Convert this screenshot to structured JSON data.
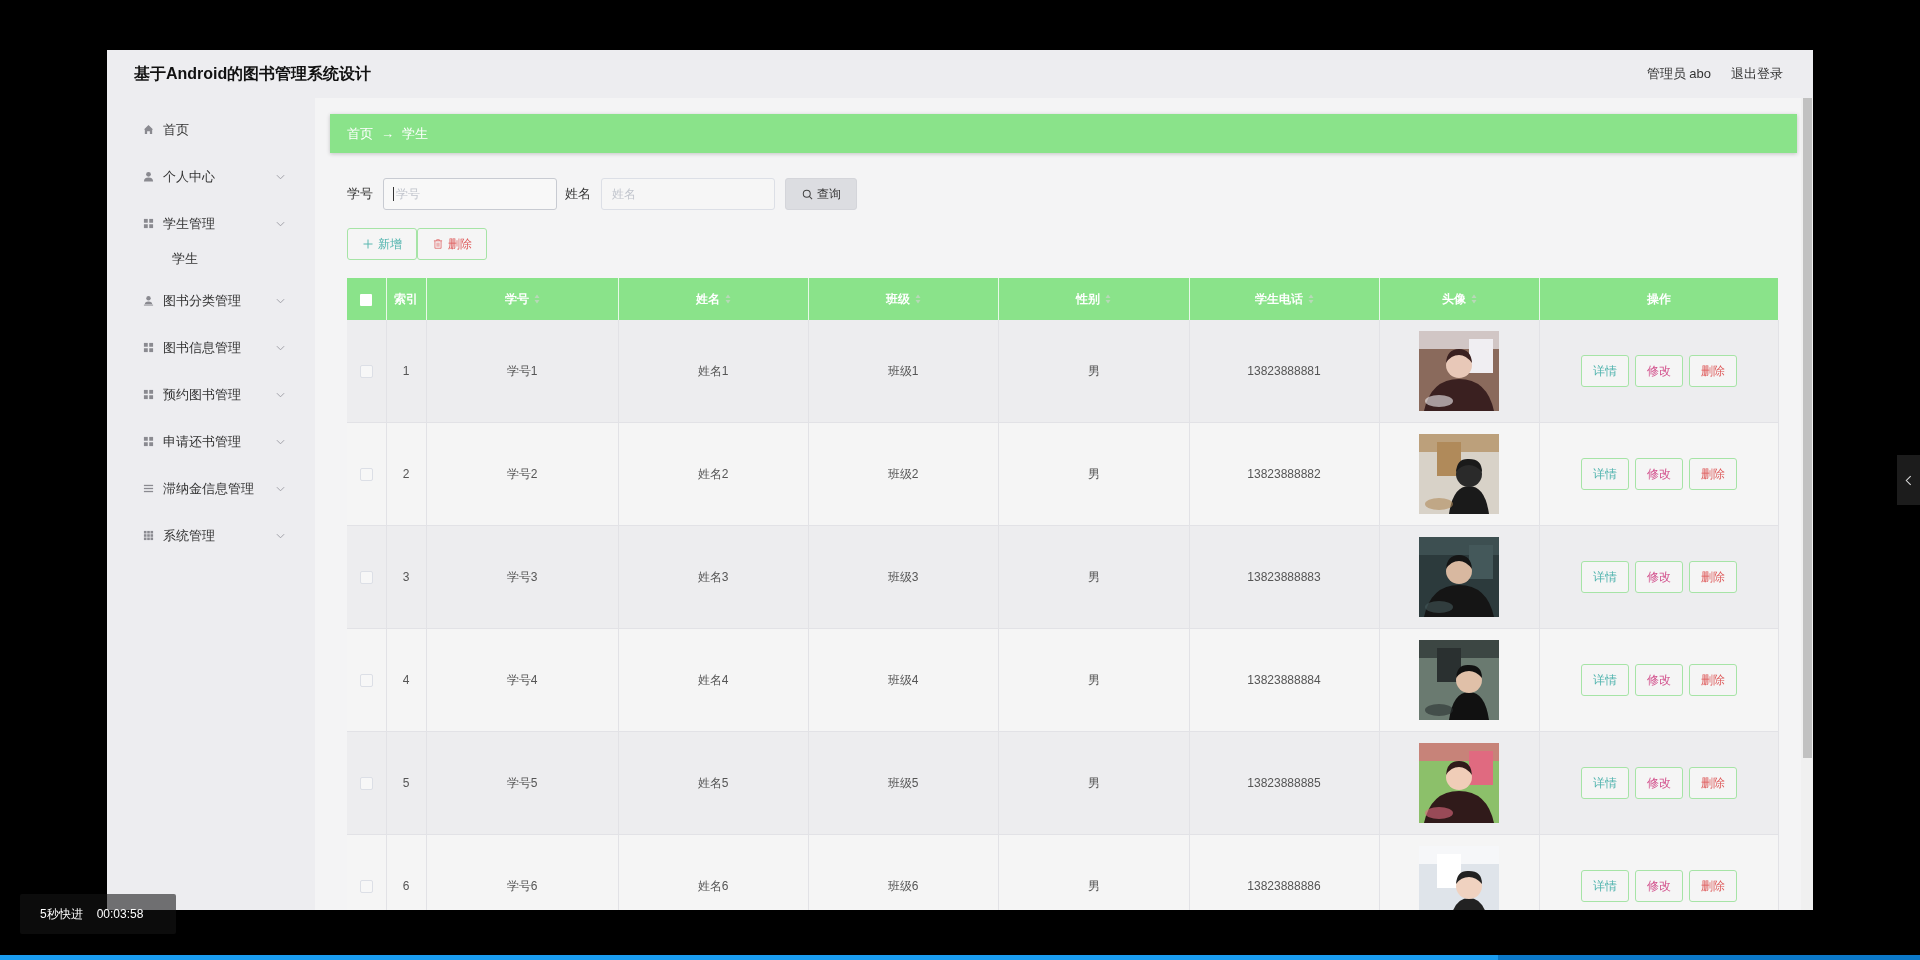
{
  "header": {
    "title": "基于Android的图书管理系统设计",
    "user": "管理员 abo",
    "logout": "退出登录"
  },
  "sidebar": {
    "items": [
      {
        "label": "首页",
        "kind": "link"
      },
      {
        "label": "个人中心",
        "kind": "submenu"
      },
      {
        "label": "学生管理",
        "kind": "submenu",
        "children": [
          {
            "label": "学生"
          }
        ]
      },
      {
        "label": "图书分类管理",
        "kind": "submenu"
      },
      {
        "label": "图书信息管理",
        "kind": "submenu"
      },
      {
        "label": "预约图书管理",
        "kind": "submenu"
      },
      {
        "label": "申请还书管理",
        "kind": "submenu"
      },
      {
        "label": "滞纳金信息管理",
        "kind": "submenu"
      },
      {
        "label": "系统管理",
        "kind": "submenu"
      }
    ]
  },
  "breadcrumb": [
    "首页",
    "→",
    "学生"
  ],
  "search": {
    "fields": [
      {
        "label": "学号",
        "placeholder": "学号",
        "focused": true
      },
      {
        "label": "姓名",
        "placeholder": "姓名",
        "focused": false
      }
    ],
    "button": "查询"
  },
  "actions": [
    {
      "label": "新增",
      "kind": "add"
    },
    {
      "label": "删除",
      "kind": "delete"
    }
  ],
  "table": {
    "select_all_checked": false,
    "columns": [
      {
        "label": "索引",
        "sortable": false
      },
      {
        "label": "学号",
        "sortable": true
      },
      {
        "label": "姓名",
        "sortable": true
      },
      {
        "label": "班级",
        "sortable": true
      },
      {
        "label": "性别",
        "sortable": true
      },
      {
        "label": "学生电话",
        "sortable": true
      },
      {
        "label": "头像",
        "sortable": true
      },
      {
        "label": "操作",
        "sortable": false
      }
    ],
    "rows": [
      {
        "checked": false,
        "index": "1",
        "student_id": "学号1",
        "name": "姓名1",
        "class": "班级1",
        "gender": "男",
        "phone": "13823888881",
        "buttons": [
          {
            "label": "详情",
            "kind": "detail"
          },
          {
            "label": "修改",
            "kind": "edit"
          },
          {
            "label": "删除",
            "kind": "delete"
          }
        ]
      },
      {
        "checked": false,
        "index": "2",
        "student_id": "学号2",
        "name": "姓名2",
        "class": "班级2",
        "gender": "男",
        "phone": "13823888882",
        "buttons": [
          {
            "label": "详情",
            "kind": "detail"
          },
          {
            "label": "修改",
            "kind": "edit"
          },
          {
            "label": "删除",
            "kind": "delete"
          }
        ]
      },
      {
        "checked": false,
        "index": "3",
        "student_id": "学号3",
        "name": "姓名3",
        "class": "班级3",
        "gender": "男",
        "phone": "13823888883",
        "buttons": [
          {
            "label": "详情",
            "kind": "detail"
          },
          {
            "label": "修改",
            "kind": "edit"
          },
          {
            "label": "删除",
            "kind": "delete"
          }
        ]
      },
      {
        "checked": false,
        "index": "4",
        "student_id": "学号4",
        "name": "姓名4",
        "class": "班级4",
        "gender": "男",
        "phone": "13823888884",
        "buttons": [
          {
            "label": "详情",
            "kind": "detail"
          },
          {
            "label": "修改",
            "kind": "edit"
          },
          {
            "label": "删除",
            "kind": "delete"
          }
        ]
      },
      {
        "checked": false,
        "index": "5",
        "student_id": "学号5",
        "name": "姓名5",
        "class": "班级5",
        "gender": "男",
        "phone": "13823888885",
        "buttons": [
          {
            "label": "详情",
            "kind": "detail"
          },
          {
            "label": "修改",
            "kind": "edit"
          },
          {
            "label": "删除",
            "kind": "delete"
          }
        ]
      },
      {
        "checked": false,
        "index": "6",
        "student_id": "学号6",
        "name": "姓名6",
        "class": "班级6",
        "gender": "男",
        "phone": "13823888886",
        "buttons": [
          {
            "label": "详情",
            "kind": "detail"
          },
          {
            "label": "修改",
            "kind": "edit"
          },
          {
            "label": "删除",
            "kind": "delete"
          }
        ]
      }
    ]
  },
  "player": {
    "hint": "5秒快进",
    "time": "00:03:58",
    "progress": {
      "level": 0.78
    }
  }
}
